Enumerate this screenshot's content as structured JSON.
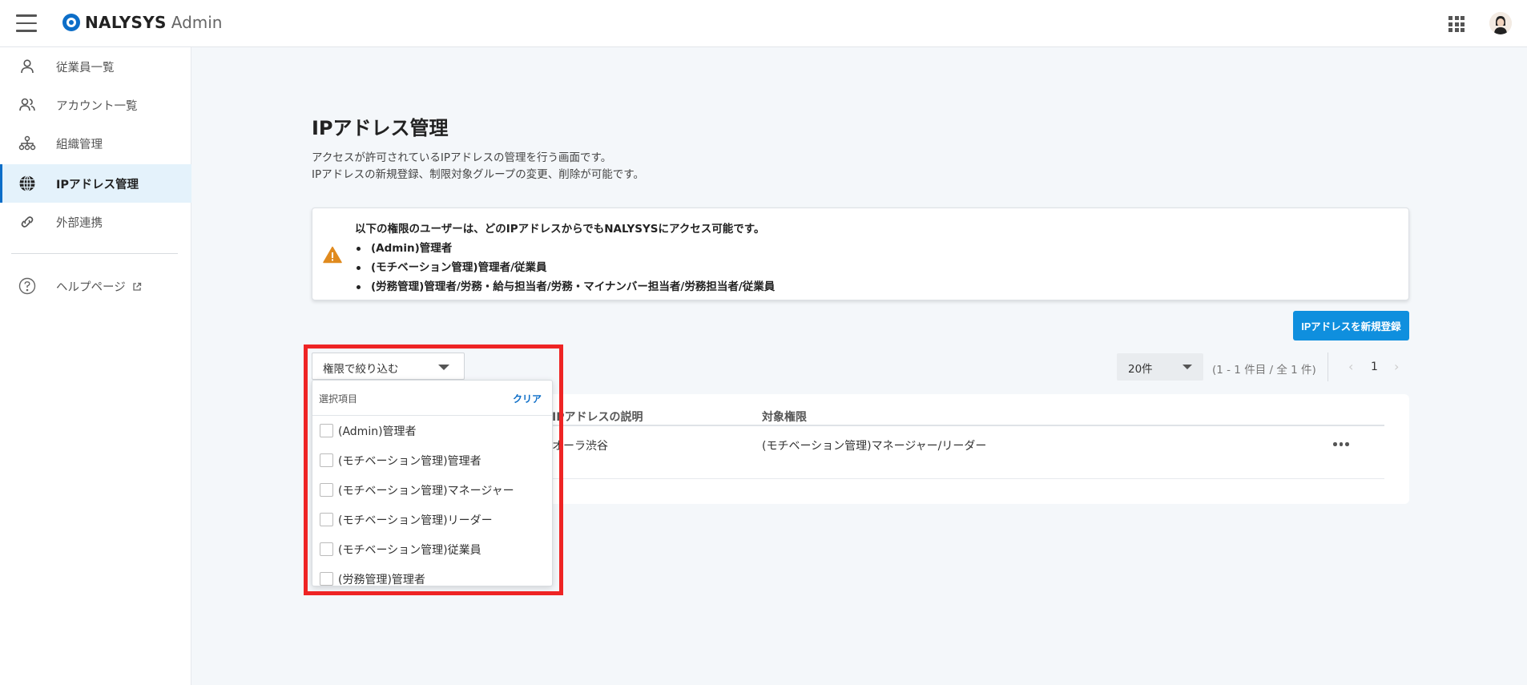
{
  "header": {
    "logo_text": "NALYSYS",
    "logo_sub": "Admin"
  },
  "sidebar": {
    "items": [
      {
        "label": "従業員一覧",
        "icon": "person-icon"
      },
      {
        "label": "アカウント一覧",
        "icon": "people-icon"
      },
      {
        "label": "組織管理",
        "icon": "org-chart-icon"
      },
      {
        "label": "IPアドレス管理",
        "icon": "globe-icon",
        "active": true
      },
      {
        "label": "外部連携",
        "icon": "link-icon"
      }
    ],
    "help": {
      "label": "ヘルプページ",
      "icon": "help-circle-icon"
    }
  },
  "main": {
    "title": "IPアドレス管理",
    "description_line1": "アクセスが許可されているIPアドレスの管理を行う画面です。",
    "description_line2": "IPアドレスの新規登録、制限対象グループの変更、削除が可能です。",
    "notice": {
      "heading": "以下の権限のユーザーは、どのIPアドレスからでもNALYSYSにアクセス可能です。",
      "items": [
        "(Admin)管理者",
        "(モチベーション管理)管理者/従業員",
        "(労務管理)管理者/労務・給与担当者/労務・マイナンバー担当者/労務担当者/従業員"
      ]
    },
    "new_button_label": "IPアドレスを新規登録",
    "filter": {
      "placeholder": "権限で絞り込む",
      "dropdown_title": "選択項目",
      "clear_label": "クリア",
      "options": [
        "(Admin)管理者",
        "(モチベーション管理)管理者",
        "(モチベーション管理)マネージャー",
        "(モチベーション管理)リーダー",
        "(モチベーション管理)従業員",
        "(労務管理)管理者"
      ]
    },
    "pagination": {
      "per_page": "20件",
      "range": "(1 - 1 件目 / 全 1 件)",
      "current_page": "1",
      "prev_icon": "chevron-left-icon",
      "next_icon": "chevron-right-icon"
    },
    "table": {
      "columns": [
        "IPアドレスの説明",
        "対象権限"
      ],
      "rows": [
        {
          "description": "オーラ渋谷",
          "permissions": "(モチベーション管理)マネージャー/リーダー"
        }
      ]
    }
  },
  "colors": {
    "accent": "#0d6ec8",
    "button": "#0f8fde",
    "warning": "#e08a1e",
    "highlight": "#ee2424"
  }
}
